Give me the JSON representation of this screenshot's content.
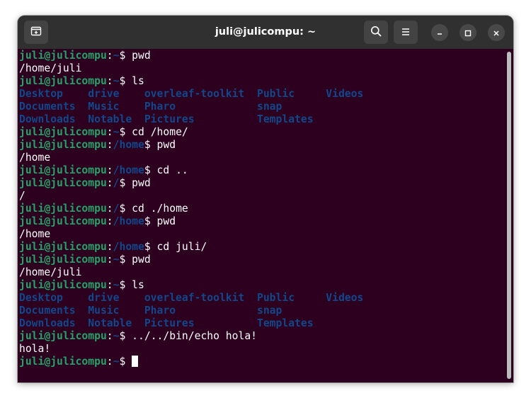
{
  "window": {
    "title": "juli@julicompu: ~",
    "new_tab_icon": "new-tab-icon",
    "search_icon": "search-icon",
    "menu_icon": "hamburger-menu-icon",
    "minimize_icon": "minimize-icon",
    "maximize_icon": "maximize-icon",
    "close_icon": "close-icon"
  },
  "colors": {
    "terminal_bg": "#2c001e",
    "titlebar_bg": "#303030",
    "prompt_user": "#26a269",
    "prompt_path": "#12488b",
    "directory": "#12488b",
    "text": "#ffffff"
  },
  "terminal": {
    "lines": [
      {
        "kind": "cmd",
        "user": "juli@julicompu",
        "sep": ":",
        "path": "~",
        "sym": "$ ",
        "cmd": "pwd"
      },
      {
        "kind": "out",
        "text": "/home/juli"
      },
      {
        "kind": "cmd",
        "user": "juli@julicompu",
        "sep": ":",
        "path": "~",
        "sym": "$ ",
        "cmd": "ls"
      },
      {
        "kind": "ls",
        "cols": [
          "Desktop",
          "drive",
          "overleaf-toolkit",
          "Public",
          "Videos"
        ]
      },
      {
        "kind": "ls",
        "cols": [
          "Documents",
          "Music",
          "Pharo",
          "snap",
          ""
        ]
      },
      {
        "kind": "ls",
        "cols": [
          "Downloads",
          "Notable",
          "Pictures",
          "Templates",
          ""
        ]
      },
      {
        "kind": "cmd",
        "user": "juli@julicompu",
        "sep": ":",
        "path": "~",
        "sym": "$ ",
        "cmd": "cd /home/"
      },
      {
        "kind": "cmd",
        "user": "juli@julicompu",
        "sep": ":",
        "path": "/home",
        "sym": "$ ",
        "cmd": "pwd"
      },
      {
        "kind": "out",
        "text": "/home"
      },
      {
        "kind": "cmd",
        "user": "juli@julicompu",
        "sep": ":",
        "path": "/home",
        "sym": "$ ",
        "cmd": "cd .."
      },
      {
        "kind": "cmd",
        "user": "juli@julicompu",
        "sep": ":",
        "path": "/",
        "sym": "$ ",
        "cmd": "pwd"
      },
      {
        "kind": "out",
        "text": "/"
      },
      {
        "kind": "cmd",
        "user": "juli@julicompu",
        "sep": ":",
        "path": "/",
        "sym": "$ ",
        "cmd": "cd ./home"
      },
      {
        "kind": "cmd",
        "user": "juli@julicompu",
        "sep": ":",
        "path": "/home",
        "sym": "$ ",
        "cmd": "pwd"
      },
      {
        "kind": "out",
        "text": "/home"
      },
      {
        "kind": "cmd",
        "user": "juli@julicompu",
        "sep": ":",
        "path": "/home",
        "sym": "$ ",
        "cmd": "cd juli/"
      },
      {
        "kind": "cmd",
        "user": "juli@julicompu",
        "sep": ":",
        "path": "~",
        "sym": "$ ",
        "cmd": "pwd"
      },
      {
        "kind": "out",
        "text": "/home/juli"
      },
      {
        "kind": "cmd",
        "user": "juli@julicompu",
        "sep": ":",
        "path": "~",
        "sym": "$ ",
        "cmd": "ls"
      },
      {
        "kind": "ls",
        "cols": [
          "Desktop",
          "drive",
          "overleaf-toolkit",
          "Public",
          "Videos"
        ]
      },
      {
        "kind": "ls",
        "cols": [
          "Documents",
          "Music",
          "Pharo",
          "snap",
          ""
        ]
      },
      {
        "kind": "ls",
        "cols": [
          "Downloads",
          "Notable",
          "Pictures",
          "Templates",
          ""
        ]
      },
      {
        "kind": "cmd",
        "user": "juli@julicompu",
        "sep": ":",
        "path": "~",
        "sym": "$ ",
        "cmd": "../../bin/echo hola!"
      },
      {
        "kind": "out",
        "text": "hola!"
      },
      {
        "kind": "prompt",
        "user": "juli@julicompu",
        "sep": ":",
        "path": "~",
        "sym": "$ ",
        "cmd": ""
      }
    ]
  }
}
